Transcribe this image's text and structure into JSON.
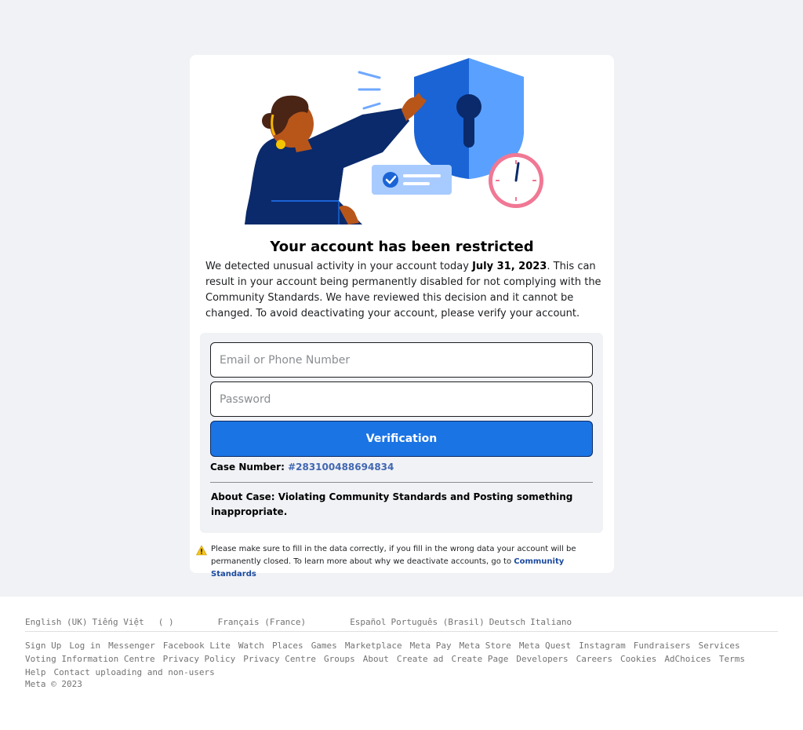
{
  "card": {
    "title": "Your account has been restricted",
    "description_pre": "We detected unusual activity in your account today ",
    "description_date": "July 31, 2023",
    "description_post": ". This can result in your account being permanently disabled for not complying with the Community Standards. We have reviewed this decision and it cannot be changed. To avoid deactivating your account, please verify your account."
  },
  "form": {
    "email_placeholder": "Email or Phone Number",
    "password_placeholder": "Password",
    "verify_label": "Verification",
    "case_label": "Case Number: ",
    "case_number": "#283100488694834",
    "about": "About Case: Violating Community Standards and Posting something inappropriate."
  },
  "warning": {
    "text": "Please make sure to fill in the data correctly, if you fill in the wrong data your account will be permanently closed. To learn more about why we deactivate accounts, go to ",
    "link": "Community Standards"
  },
  "footer": {
    "languages": [
      "English (UK)",
      "Tiếng Việt",
      "(  )",
      "Français (France)",
      "Español",
      "Português (Brasil)",
      "Deutsch",
      "Italiano"
    ],
    "links": [
      "Sign Up",
      "Log in",
      "Messenger",
      "Facebook Lite",
      "Watch",
      "Places",
      "Games",
      "Marketplace",
      "Meta Pay",
      "Meta Store",
      "Meta Quest",
      "Instagram",
      "Fundraisers",
      "Services",
      "Voting Information Centre",
      "Privacy Policy",
      "Privacy Centre",
      "Groups",
      "About",
      "Create ad",
      "Create Page",
      "Developers",
      "Careers",
      "Cookies",
      "AdChoices",
      "Terms",
      "Help",
      "Contact uploading and non-users"
    ],
    "copyright": "Meta © 2023"
  },
  "colors": {
    "accent": "#1b74e4",
    "page_bg": "#f0f2f5",
    "link": "#4267b2"
  }
}
